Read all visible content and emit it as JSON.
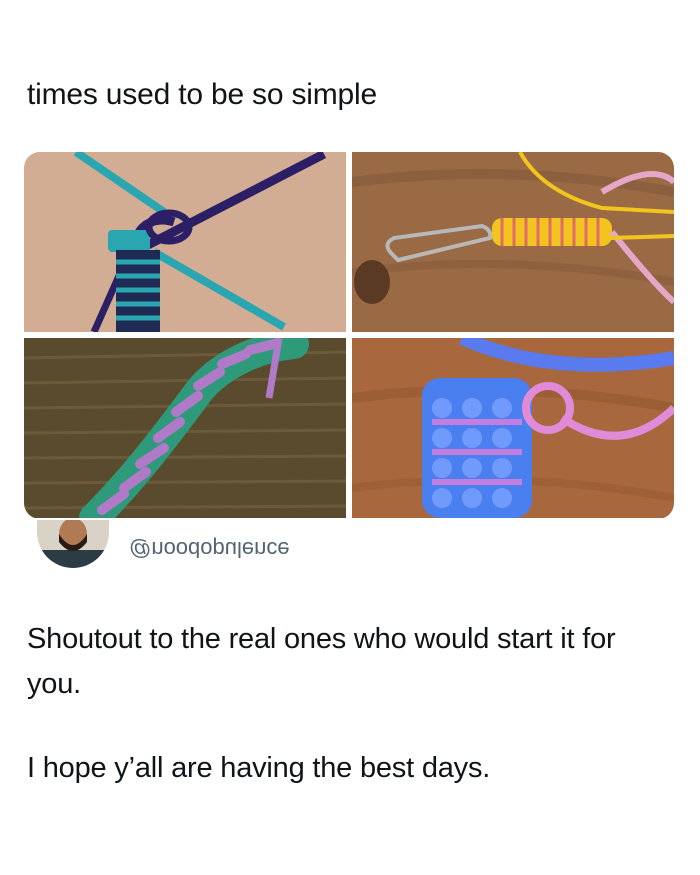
{
  "post": {
    "title": "times used to be so simple",
    "images": [
      {
        "name": "teal-and-purple-lanyard-start",
        "icon": "lanyard-photo"
      },
      {
        "name": "yellow-lanyard-on-keyclip",
        "icon": "lanyard-photo"
      },
      {
        "name": "green-and-purple-twist-lanyard",
        "icon": "lanyard-photo"
      },
      {
        "name": "blue-and-pink-box-stitch-lanyard",
        "icon": "lanyard-photo"
      }
    ],
    "quoted_author": {
      "handle": "@noodopulence",
      "avatar_icon": "avatar-photo"
    },
    "body": [
      "Shoutout to the real ones who would start it for you.",
      "I hope y’all are having the best days."
    ]
  }
}
